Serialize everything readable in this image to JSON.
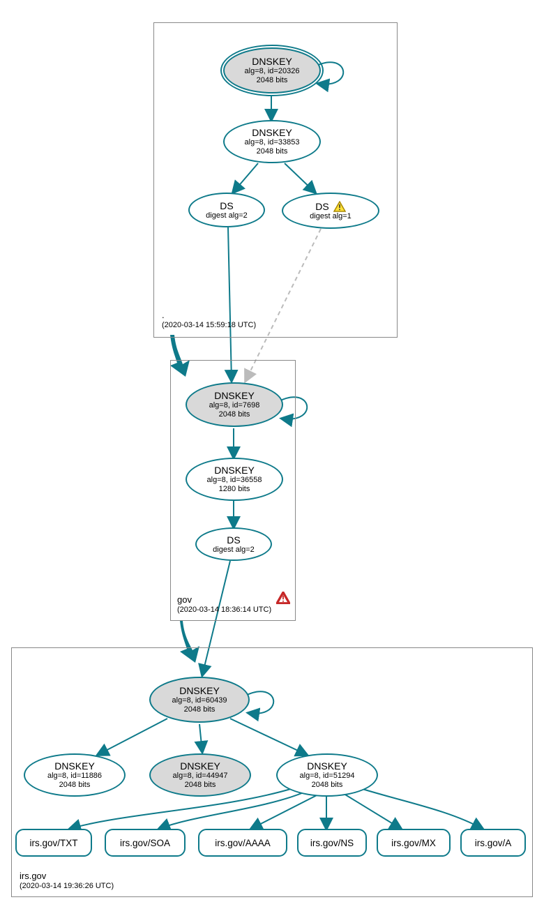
{
  "colors": {
    "accent": "#0e7a8a",
    "node_fill_gray": "#d9d9d9",
    "zone_border": "#888888",
    "edge_dashed": "#bbbbbb",
    "warn_yellow": "#ffe23a",
    "warn_red": "#c62828"
  },
  "zones": {
    "root": {
      "label": ".",
      "timestamp": "(2020-03-14 15:59:18 UTC)"
    },
    "gov": {
      "label": "gov",
      "timestamp": "(2020-03-14 18:36:14 UTC)",
      "error": true
    },
    "irs": {
      "label": "irs.gov",
      "timestamp": "(2020-03-14 19:36:26 UTC)"
    }
  },
  "nodes": {
    "root_ksk": {
      "title": "DNSKEY",
      "line2": "alg=8, id=20326",
      "line3": "2048 bits"
    },
    "root_zsk": {
      "title": "DNSKEY",
      "line2": "alg=8, id=33853",
      "line3": "2048 bits"
    },
    "root_ds2": {
      "title": "DS",
      "line2": "digest alg=2",
      "line3": ""
    },
    "root_ds1": {
      "title": "DS",
      "line2": "digest alg=1",
      "line3": "",
      "warn": "yellow"
    },
    "gov_ksk": {
      "title": "DNSKEY",
      "line2": "alg=8, id=7698",
      "line3": "2048 bits"
    },
    "gov_zsk": {
      "title": "DNSKEY",
      "line2": "alg=8, id=36558",
      "line3": "1280 bits"
    },
    "gov_ds": {
      "title": "DS",
      "line2": "digest alg=2",
      "line3": ""
    },
    "irs_ksk": {
      "title": "DNSKEY",
      "line2": "alg=8, id=60439",
      "line3": "2048 bits"
    },
    "irs_key_a": {
      "title": "DNSKEY",
      "line2": "alg=8, id=11886",
      "line3": "2048 bits"
    },
    "irs_key_b": {
      "title": "DNSKEY",
      "line2": "alg=8, id=44947",
      "line3": "2048 bits"
    },
    "irs_key_c": {
      "title": "DNSKEY",
      "line2": "alg=8, id=51294",
      "line3": "2048 bits"
    }
  },
  "rrsets": [
    "irs.gov/TXT",
    "irs.gov/SOA",
    "irs.gov/AAAA",
    "irs.gov/NS",
    "irs.gov/MX",
    "irs.gov/A"
  ]
}
